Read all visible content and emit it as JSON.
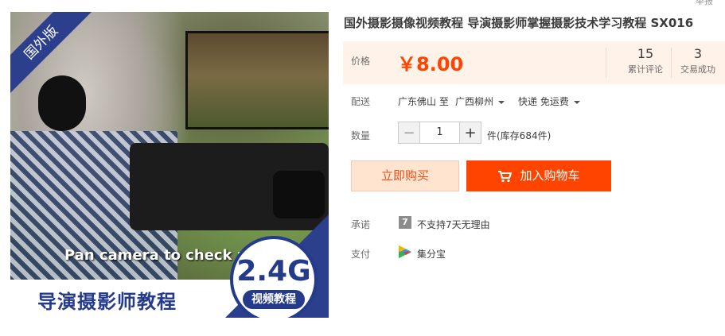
{
  "product": {
    "title": "国外摄影摄像视频教程 导演摄影师掌握摄影技术学习教程 SX016",
    "image": {
      "ribbon": "国外版",
      "subtitle": "Pan camera to check m",
      "bottom_title": "导演摄影师教程",
      "badge_big": "2.4G",
      "badge_small": "视频教程"
    }
  },
  "top_cut_text": "举报",
  "price": {
    "label": "价格",
    "value": "￥8.00",
    "reviews_count": "15",
    "reviews_label": "累计评论",
    "deals_count": "3",
    "deals_label": "交易成功"
  },
  "delivery": {
    "label": "配送",
    "from": "广东佛山 至",
    "to": "广西柳州",
    "shipping": "快递 免运费"
  },
  "quantity": {
    "label": "数量",
    "minus": "−",
    "value": "1",
    "plus": "+",
    "stock": "件(库存684件)"
  },
  "buttons": {
    "buy_now": "立即购买",
    "add_cart": "加入购物车"
  },
  "promise": {
    "label": "承诺",
    "icon_text": "7",
    "text": "不支持7天无理由"
  },
  "payment": {
    "label": "支付",
    "text": "集分宝"
  },
  "colors": {
    "accent": "#ff4400",
    "price_bg": "#fff2e8",
    "brand_blue": "#243a8a"
  }
}
